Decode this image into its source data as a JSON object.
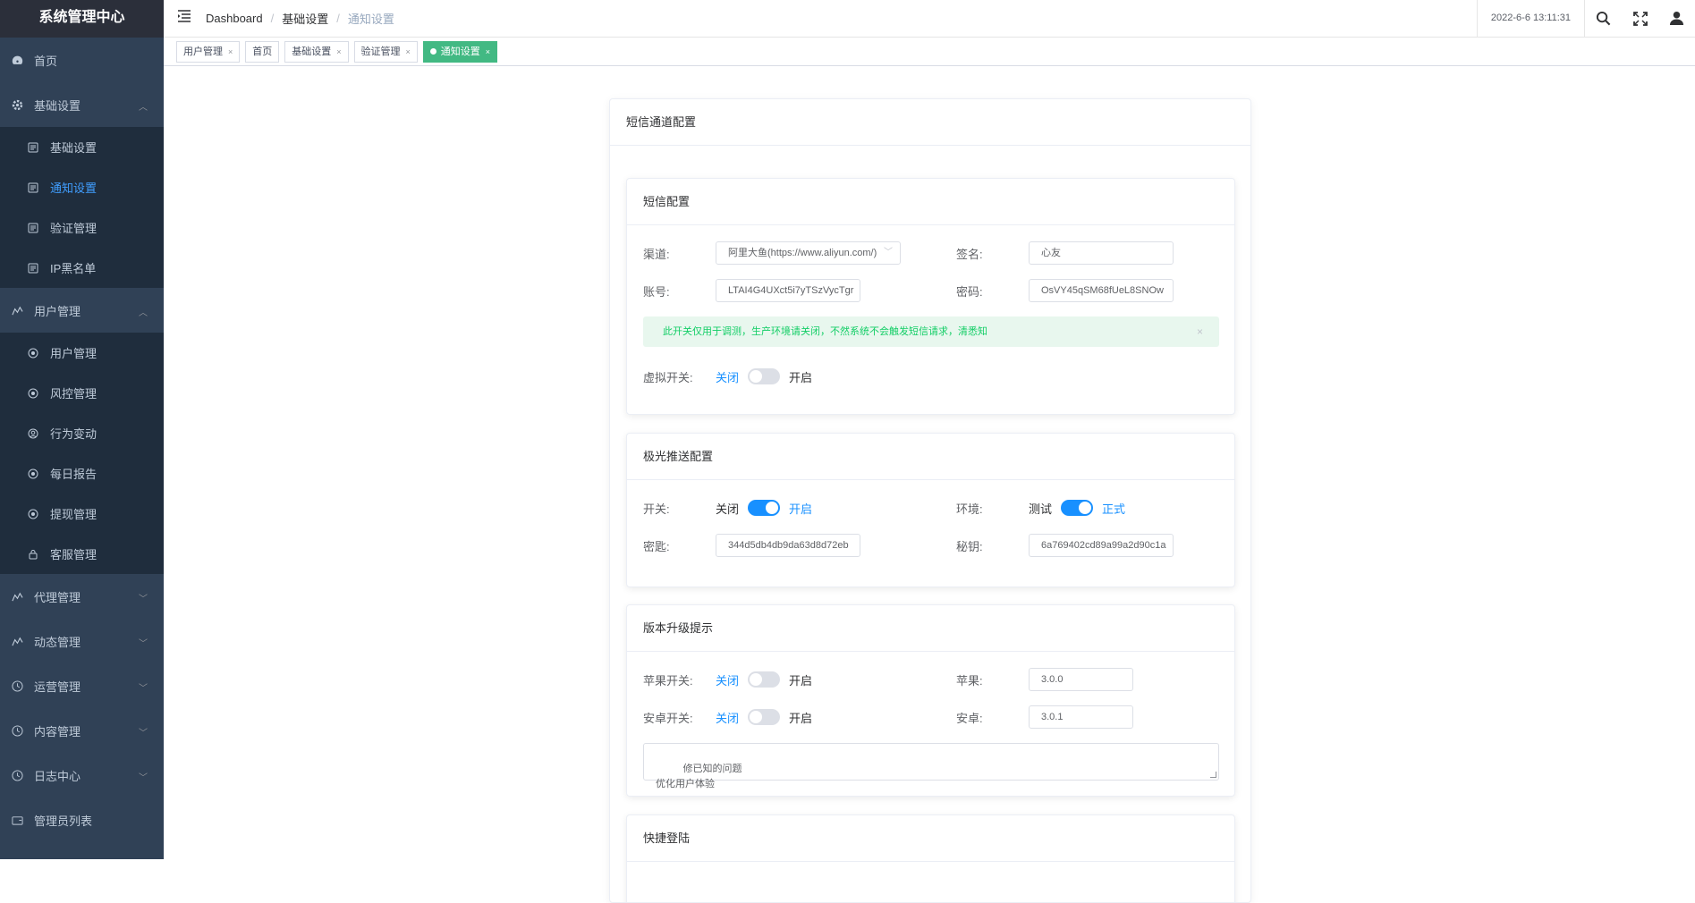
{
  "app": {
    "title": "系统管理中心"
  },
  "sidebar": {
    "items": [
      {
        "label": "首页"
      },
      {
        "label": "基础设置",
        "children": [
          {
            "label": "基础设置"
          },
          {
            "label": "通知设置",
            "active": true
          },
          {
            "label": "验证管理"
          },
          {
            "label": "IP黑名单"
          }
        ]
      },
      {
        "label": "用户管理",
        "children": [
          {
            "label": "用户管理"
          },
          {
            "label": "风控管理"
          },
          {
            "label": "行为变动"
          },
          {
            "label": "每日报告"
          },
          {
            "label": "提现管理"
          },
          {
            "label": "客服管理"
          }
        ]
      },
      {
        "label": "代理管理"
      },
      {
        "label": "动态管理"
      },
      {
        "label": "运营管理"
      },
      {
        "label": "内容管理"
      },
      {
        "label": "日志中心"
      },
      {
        "label": "管理员列表"
      }
    ]
  },
  "navbar": {
    "breadcrumb": [
      "Dashboard",
      "基础设置",
      "通知设置"
    ],
    "datetime": "2022-6-6 13:11:31"
  },
  "tags": [
    {
      "label": "用户管理",
      "close": "×"
    },
    {
      "label": "首页"
    },
    {
      "label": "基础设置",
      "close": "×"
    },
    {
      "label": "验证管理",
      "close": "×"
    },
    {
      "label": "通知设置",
      "close": "×",
      "active": true
    }
  ],
  "page": {
    "title": "短信通道配置",
    "sms": {
      "title": "短信配置",
      "channel_label": "渠道:",
      "channel_value": "阿里大鱼(https://www.aliyun.com/)",
      "sign_label": "签名:",
      "sign_value": "心友",
      "account_label": "账号:",
      "account_value": "LTAI4G4UXct5i7yTSzVycTgr",
      "password_label": "密码:",
      "password_value": "OsVY45qSM68fUeL8SNOw",
      "alert": "此开关仅用于调测，生产环境请关闭，不然系统不会触发短信请求，清悉知",
      "alert_close": "×",
      "virtual_label": "虚拟开关:",
      "virtual_off": "关闭",
      "virtual_on": "开启",
      "virtual_state": false
    },
    "jpush": {
      "title": "极光推送配置",
      "switch_label": "开关:",
      "switch_off": "关闭",
      "switch_on": "开启",
      "switch_state": true,
      "env_label": "环境:",
      "env_off": "测试",
      "env_on": "正式",
      "env_state": true,
      "key_label": "密匙:",
      "key_value": "344d5db4db9da63d8d72eb",
      "secret_label": "秘钥:",
      "secret_value": "6a769402cd89a99a2d90c1a"
    },
    "version": {
      "title": "版本升级提示",
      "apple_switch_label": "苹果开关:",
      "apple_off": "关闭",
      "apple_on": "开启",
      "apple_state": false,
      "apple_label": "苹果:",
      "apple_value": "3.0.0",
      "android_switch_label": "安卓开关:",
      "android_off": "关闭",
      "android_on": "开启",
      "android_state": false,
      "android_label": "安卓:",
      "android_value": "3.0.1",
      "notes": "修已知的问题\n优化用户体验"
    },
    "quick_login": {
      "title": "快捷登陆"
    }
  }
}
